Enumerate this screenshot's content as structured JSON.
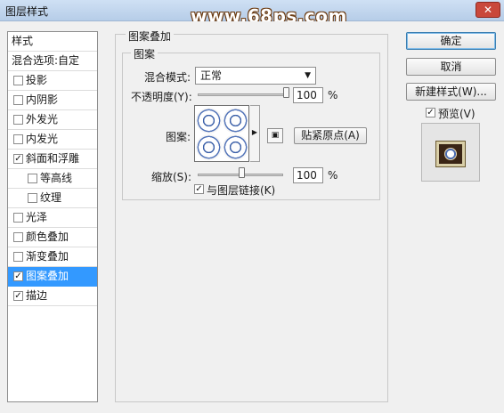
{
  "window": {
    "title": "图层样式",
    "watermark": "www.68ps.com",
    "close_label": "✕"
  },
  "sidebar": {
    "header": "样式",
    "blend_options": "混合选项:自定",
    "items": [
      {
        "label": "投影",
        "checked": false,
        "indent": false,
        "selected": false
      },
      {
        "label": "内阴影",
        "checked": false,
        "indent": false,
        "selected": false
      },
      {
        "label": "外发光",
        "checked": false,
        "indent": false,
        "selected": false
      },
      {
        "label": "内发光",
        "checked": false,
        "indent": false,
        "selected": false
      },
      {
        "label": "斜面和浮雕",
        "checked": true,
        "indent": false,
        "selected": false
      },
      {
        "label": "等高线",
        "checked": false,
        "indent": true,
        "selected": false
      },
      {
        "label": "纹理",
        "checked": false,
        "indent": true,
        "selected": false
      },
      {
        "label": "光泽",
        "checked": false,
        "indent": false,
        "selected": false
      },
      {
        "label": "颜色叠加",
        "checked": false,
        "indent": false,
        "selected": false
      },
      {
        "label": "渐变叠加",
        "checked": false,
        "indent": false,
        "selected": false
      },
      {
        "label": "图案叠加",
        "checked": true,
        "indent": false,
        "selected": true
      },
      {
        "label": "描边",
        "checked": true,
        "indent": false,
        "selected": false
      }
    ]
  },
  "panel": {
    "group_title": "图案叠加",
    "section_title": "图案",
    "blend_mode_label": "混合模式:",
    "blend_mode_value": "正常",
    "opacity_label": "不透明度(Y):",
    "opacity_value": "100",
    "opacity_unit": "%",
    "opacity_level": 1.0,
    "pattern_label": "图案:",
    "snap_origin_button": "贴紧原点(A)",
    "scale_label": "缩放(S):",
    "scale_value": "100",
    "scale_unit": "%",
    "scale_level": 0.5,
    "link_label": "与图层链接(K)",
    "link_checked": true
  },
  "actions": {
    "ok": "确定",
    "cancel": "取消",
    "new_style": "新建样式(W)...",
    "preview_label": "预览(V)",
    "preview_checked": true
  },
  "colors": {
    "selected_row": "#3399ff",
    "titlebar": "#b6cde8",
    "close": "#c9483b"
  }
}
